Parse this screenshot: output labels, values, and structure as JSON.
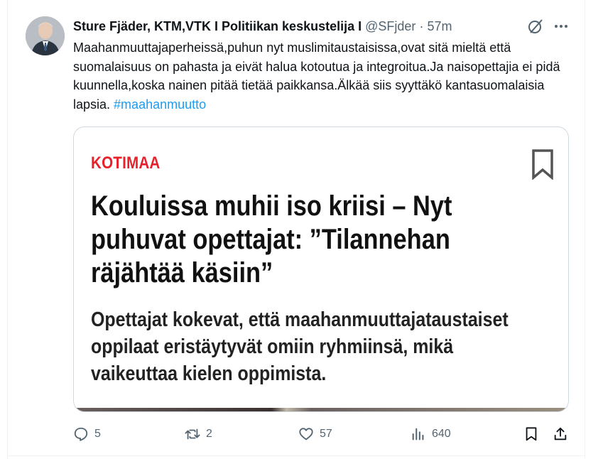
{
  "author": {
    "name": "Sture Fjäder, KTM,VTK I Politiikan keskustelija I",
    "handle": "@SFjder",
    "separator": "·",
    "time": "57m"
  },
  "tweet": {
    "text": "Maahanmuuttajaperheissä,puhun nyt muslimitaustaisissa,ovat sitä mieltä että suomalaisuus on pahasta  ja eivät halua kotoutua ja integroitua.Ja naisopettajia ei pidä kuunnella,koska nainen pitää tietää paikkansa.Älkää siis syyttäkö kantasuomalaisia lapsia.",
    "hashtag": "#maahanmuutto"
  },
  "card": {
    "category": "KOTIMAA",
    "headline": "Kouluissa muhii iso kriisi – Nyt puhuvat opettajat: ”Tilannehan räjähtää käsiin”",
    "lead": "Opettajat kokevat, että maahanmuuttajataustaiset oppilaat eristäytyvät omiin ryhmiinsä, mikä vaikeuttaa kielen oppimista."
  },
  "actions": {
    "replies": "5",
    "reposts": "2",
    "likes": "57",
    "views": "640"
  },
  "icons": {
    "grok": "grok-icon",
    "more": "more-icon",
    "reply": "reply-icon",
    "repost": "repost-icon",
    "like": "heart-icon",
    "views": "views-icon",
    "bookmark": "bookmark-icon",
    "share": "share-icon"
  },
  "colors": {
    "text": "#0f1419",
    "secondary": "#536471",
    "link": "#1d9bf0",
    "category_red": "#e8202a",
    "border": "#cfd9de"
  }
}
